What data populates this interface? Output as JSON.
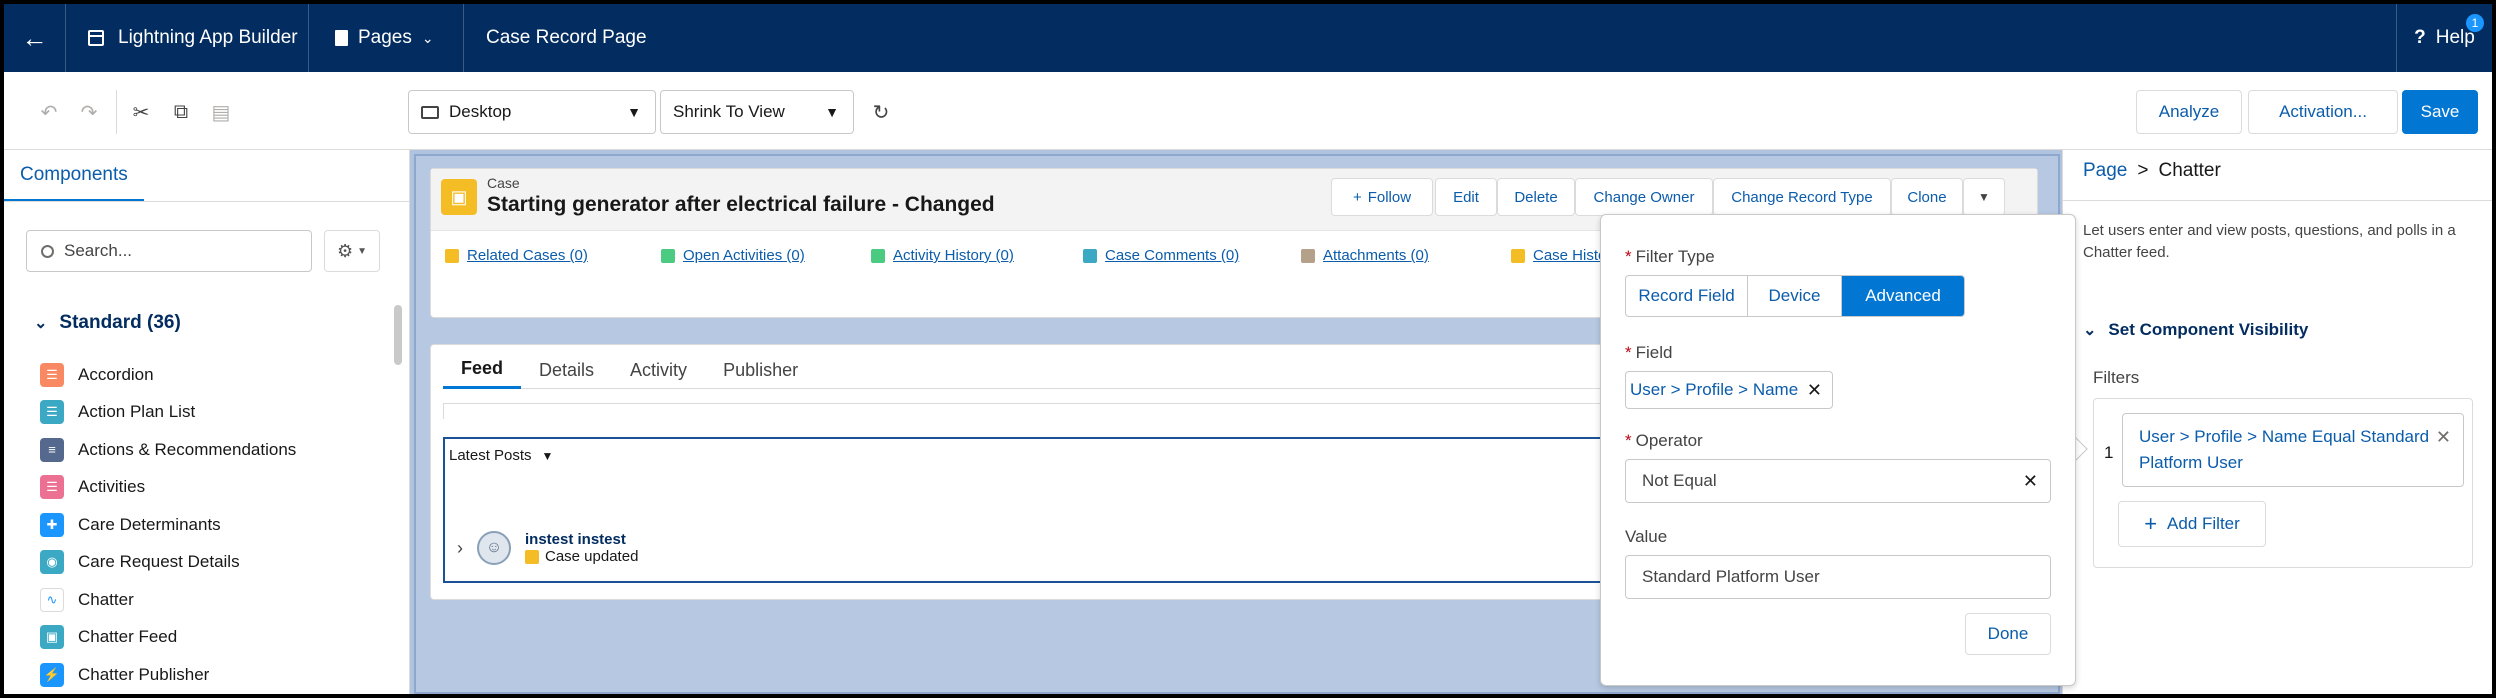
{
  "topbar": {
    "app_name": "Lightning App Builder",
    "pages_label": "Pages",
    "page_title": "Case Record Page",
    "help_label": "Help",
    "help_badge": "1"
  },
  "toolbar": {
    "device_select": "Desktop",
    "zoom_select": "Shrink To View",
    "analyze_label": "Analyze",
    "activation_label": "Activation...",
    "save_label": "Save"
  },
  "left_panel": {
    "tab_label": "Components",
    "search_placeholder": "Search...",
    "section_title": "Standard (36)",
    "items": [
      {
        "label": "Accordion",
        "icon": "accordion-icon",
        "color": "#f88962"
      },
      {
        "label": "Action Plan List",
        "icon": "action-plan-icon",
        "color": "#3ba9c4"
      },
      {
        "label": "Actions & Recommendations",
        "icon": "actions-icon",
        "color": "#54698d"
      },
      {
        "label": "Activities",
        "icon": "activities-icon",
        "color": "#eb7092"
      },
      {
        "label": "Care Determinants",
        "icon": "care-determinants-icon",
        "color": "#1b96ff"
      },
      {
        "label": "Care Request Details",
        "icon": "care-request-icon",
        "color": "#3ba9c4"
      },
      {
        "label": "Chatter",
        "icon": "chatter-icon",
        "color": "#ffffff"
      },
      {
        "label": "Chatter Feed",
        "icon": "chatter-feed-icon",
        "color": "#3ba9c4"
      },
      {
        "label": "Chatter Publisher",
        "icon": "chatter-publisher-icon",
        "color": "#1b96ff"
      }
    ]
  },
  "record": {
    "object_label": "Case",
    "title": "Starting generator after electrical failure - Changed",
    "actions": [
      "Follow",
      "Edit",
      "Delete",
      "Change Owner",
      "Change Record Type",
      "Clone"
    ],
    "related_links": [
      "Related Cases (0)",
      "Open Activities (0)",
      "Activity History (0)",
      "Case Comments (0)",
      "Attachments (0)",
      "Case Histo"
    ]
  },
  "feed": {
    "tabs": [
      "Feed",
      "Details",
      "Activity",
      "Publisher"
    ],
    "sort_label": "Latest Posts",
    "post_author": "instest instest",
    "post_text": "Case updated"
  },
  "popover": {
    "filter_type_label": "Filter Type",
    "filter_types": [
      "Record Field",
      "Device",
      "Advanced"
    ],
    "selected_filter_type": "Advanced",
    "field_label": "Field",
    "field_value": "User > Profile > Name",
    "operator_label": "Operator",
    "operator_value": "Not Equal",
    "value_label": "Value",
    "value_value": "Standard Platform User",
    "done_label": "Done"
  },
  "right_panel": {
    "breadcrumb_root": "Page",
    "breadcrumb_sep": ">",
    "breadcrumb_current": "Chatter",
    "description": "Let users enter and view posts, questions, and polls in a Chatter feed.",
    "visibility_title": "Set Component Visibility",
    "filters_label": "Filters",
    "filter_number": "1",
    "filter_text": "User > Profile > Name Equal Standard Platform User",
    "add_filter_label": "Add Filter"
  },
  "colors": {
    "header_bg": "#032d60",
    "brand_blue": "#0176d3",
    "link_blue": "#0b5cab",
    "case_icon": "#f4bc25"
  }
}
